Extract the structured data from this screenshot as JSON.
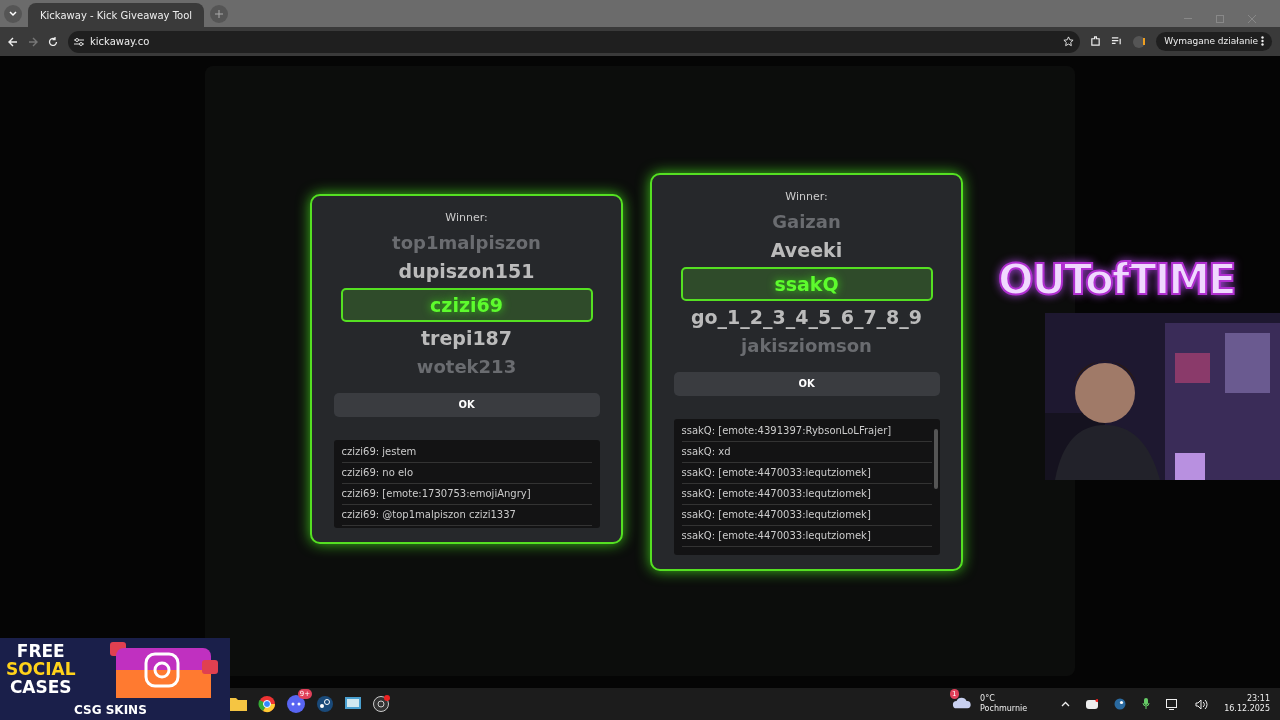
{
  "browser": {
    "tabs": [
      {
        "title": "Kickaway - Kick Giveaway Tool",
        "selected": true
      }
    ],
    "address": "kickaway.co",
    "profile_button": "Wymagane działanie"
  },
  "dialogs": [
    {
      "title": "Winner:",
      "names": [
        {
          "text": "top1malpiszon",
          "selected": false,
          "faded": true
        },
        {
          "text": "dupiszon151",
          "selected": false,
          "faded": false
        },
        {
          "text": "czizi69",
          "selected": true,
          "faded": false
        },
        {
          "text": "trepi187",
          "selected": false,
          "faded": false
        },
        {
          "text": "wotek213",
          "selected": false,
          "faded": true
        }
      ],
      "button": "OK",
      "messages": [
        "czizi69: jestem",
        "czizi69: no elo",
        "czizi69: [emote:1730753:emojiAngry]",
        "czizi69: @top1malpiszon czizi1337"
      ],
      "scrollbar": false
    },
    {
      "title": "Winner:",
      "names": [
        {
          "text": "Gaizan",
          "selected": false,
          "faded": true
        },
        {
          "text": "Aveeki",
          "selected": false,
          "faded": false
        },
        {
          "text": "ssakQ",
          "selected": true,
          "faded": false
        },
        {
          "text": "go_1_2_3_4_5_6_7_8_9",
          "selected": false,
          "faded": false
        },
        {
          "text": "jakisziomson",
          "selected": false,
          "faded": true
        }
      ],
      "button": "OK",
      "messages": [
        "ssakQ: [emote:4391397:RybsonLoLFrajer]",
        "ssakQ: xd",
        "ssakQ: [emote:4470033:lequtziomek]",
        "ssakQ: [emote:4470033:lequtziomek]",
        "ssakQ: [emote:4470033:lequtziomek]",
        "ssakQ: [emote:4470033:lequtziomek]"
      ],
      "scrollbar": true
    }
  ],
  "stream_overlay": {
    "logo": "OUTofTIME",
    "ad": {
      "headline": [
        "FREE",
        "SOCIAL",
        "CASES"
      ],
      "brand": "CSG SKINS"
    }
  },
  "taskbar": {
    "discord_badge": "9+",
    "weather": {
      "badge": "1",
      "temperature": "0°C",
      "condition": "Pochmurnie"
    },
    "time": "23:11",
    "date": "16.12.2025"
  }
}
